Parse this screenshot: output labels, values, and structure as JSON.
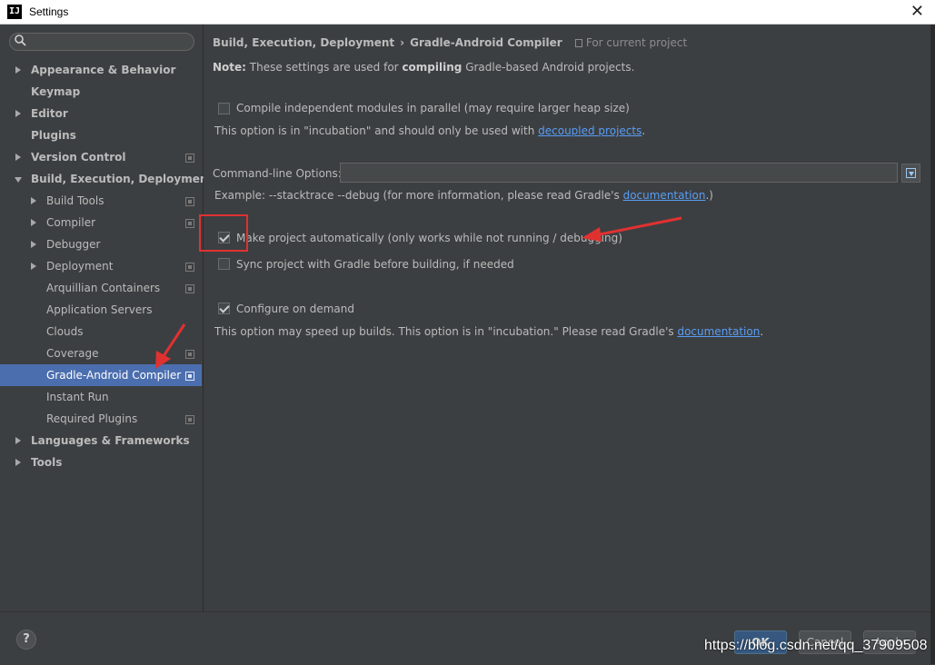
{
  "window": {
    "title": "Settings",
    "app_icon": "intellij-icon",
    "app_icon_text": "IJ"
  },
  "sidebar": {
    "search_placeholder": "",
    "items": [
      {
        "label": "Appearance & Behavior",
        "level": 0,
        "bold": true,
        "expander": "collapsed",
        "copy": false
      },
      {
        "label": "Keymap",
        "level": 0,
        "bold": true,
        "expander": "none",
        "copy": false
      },
      {
        "label": "Editor",
        "level": 0,
        "bold": true,
        "expander": "collapsed",
        "copy": false
      },
      {
        "label": "Plugins",
        "level": 0,
        "bold": true,
        "expander": "none",
        "copy": false
      },
      {
        "label": "Version Control",
        "level": 0,
        "bold": true,
        "expander": "collapsed",
        "copy": true
      },
      {
        "label": "Build, Execution, Deployment",
        "level": 0,
        "bold": true,
        "expander": "expanded",
        "copy": false
      },
      {
        "label": "Build Tools",
        "level": 1,
        "bold": false,
        "expander": "collapsed",
        "copy": true
      },
      {
        "label": "Compiler",
        "level": 1,
        "bold": false,
        "expander": "collapsed",
        "copy": true
      },
      {
        "label": "Debugger",
        "level": 1,
        "bold": false,
        "expander": "collapsed",
        "copy": false
      },
      {
        "label": "Deployment",
        "level": 1,
        "bold": false,
        "expander": "collapsed",
        "copy": true
      },
      {
        "label": "Arquillian Containers",
        "level": 1,
        "bold": false,
        "expander": "none",
        "copy": true
      },
      {
        "label": "Application Servers",
        "level": 1,
        "bold": false,
        "expander": "none",
        "copy": false
      },
      {
        "label": "Clouds",
        "level": 1,
        "bold": false,
        "expander": "none",
        "copy": false
      },
      {
        "label": "Coverage",
        "level": 1,
        "bold": false,
        "expander": "none",
        "copy": true
      },
      {
        "label": "Gradle-Android Compiler",
        "level": 1,
        "bold": false,
        "expander": "none",
        "copy": true,
        "selected": true
      },
      {
        "label": "Instant Run",
        "level": 1,
        "bold": false,
        "expander": "none",
        "copy": false
      },
      {
        "label": "Required Plugins",
        "level": 1,
        "bold": false,
        "expander": "none",
        "copy": true
      },
      {
        "label": "Languages & Frameworks",
        "level": 0,
        "bold": true,
        "expander": "collapsed",
        "copy": false
      },
      {
        "label": "Tools",
        "level": 0,
        "bold": true,
        "expander": "collapsed",
        "copy": false
      }
    ]
  },
  "main": {
    "breadcrumb": {
      "parent": "Build, Execution, Deployment",
      "separator": "›",
      "current": "Gradle-Android Compiler",
      "scope": "For current project"
    },
    "note": {
      "label": "Note:",
      "before": " These settings are used for ",
      "bold": "compiling",
      "after": " Gradle-based Android projects."
    },
    "parallel": {
      "label": "Compile independent modules in parallel (may require larger heap size)",
      "checked": false,
      "hint_before": "This option is in \"incubation\" and should only be used with ",
      "hint_link": "decoupled projects",
      "hint_after": "."
    },
    "cmdline": {
      "label": "Command-line Options:",
      "value": "",
      "example_before": "Example: --stacktrace --debug (for more information, please read Gradle's ",
      "example_link": "documentation",
      "example_after": ".)"
    },
    "make_auto": {
      "label": "Make project automatically (only works while not running / debugging)",
      "checked": true
    },
    "sync": {
      "label": "Sync project with Gradle before building, if needed",
      "checked": false
    },
    "configure": {
      "label": "Configure on demand",
      "checked": true,
      "hint_before": "This option may speed up builds. This option is in \"incubation.\" Please read Gradle's ",
      "hint_link": "documentation",
      "hint_after": "."
    }
  },
  "footer": {
    "help": "?",
    "ok": "OK",
    "cancel": "Cancel",
    "apply": "Apply",
    "watermark": "https://blog.csdn.net/qq_37909508"
  },
  "colors": {
    "background": "#3c3f41",
    "selection": "#4b6eaf",
    "link": "#589df6",
    "annotation": "#e03131"
  }
}
